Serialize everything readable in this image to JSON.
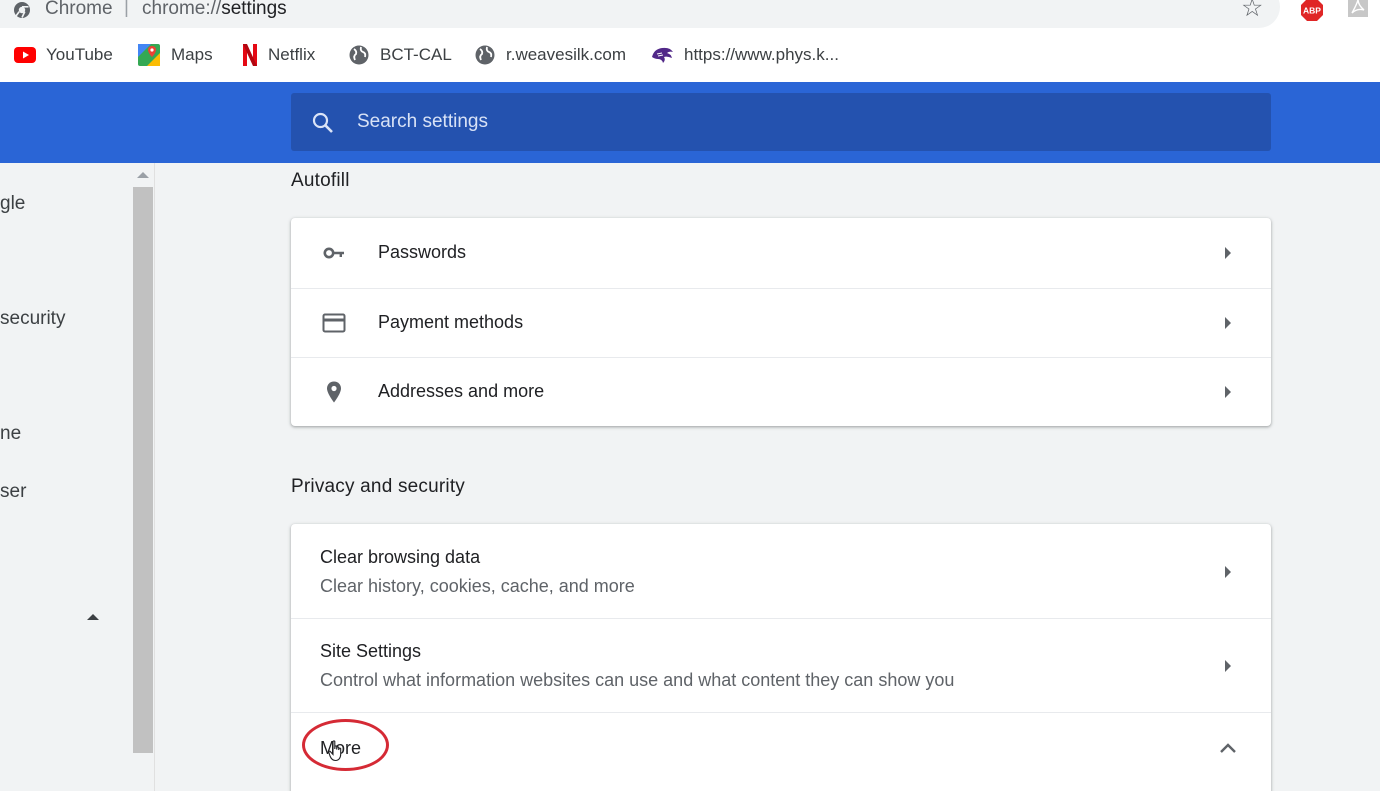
{
  "browser": {
    "site_label": "Chrome",
    "separator": "|",
    "url_prefix": "chrome://",
    "url_host": "settings",
    "icons": [
      "site-info-icon",
      "bookmark-star-icon",
      "adblock-plus-icon",
      "pdf-extension-icon"
    ]
  },
  "bookmarks": [
    {
      "label": "YouTube",
      "icon": "youtube-icon"
    },
    {
      "label": "Maps",
      "icon": "maps-icon"
    },
    {
      "label": "Netflix",
      "icon": "netflix-icon"
    },
    {
      "label": "BCT-CAL",
      "icon": "globe-icon"
    },
    {
      "label": "r.weavesilk.com",
      "icon": "globe-icon"
    },
    {
      "label": "https://www.phys.k...",
      "icon": "wildcat-icon"
    }
  ],
  "search": {
    "placeholder": "Search settings"
  },
  "sidebar": {
    "items": [
      {
        "label": "gle"
      },
      {
        "label": "security"
      },
      {
        "label": "ne"
      },
      {
        "label": "ser"
      }
    ]
  },
  "autofill": {
    "title": "Autofill",
    "rows": [
      {
        "label": "Passwords",
        "icon": "key-icon"
      },
      {
        "label": "Payment methods",
        "icon": "credit-card-icon"
      },
      {
        "label": "Addresses and more",
        "icon": "location-pin-icon"
      }
    ]
  },
  "privacy": {
    "title": "Privacy and security",
    "rows": [
      {
        "title": "Clear browsing data",
        "subtitle": "Clear history, cookies, cache, and more"
      },
      {
        "title": "Site Settings",
        "subtitle": "Control what information websites can use and what content they can show you"
      }
    ],
    "more_label": "More"
  },
  "colors": {
    "header_blue": "#2a65d6",
    "search_blue": "#2452af",
    "highlight_red": "#d52a35"
  }
}
